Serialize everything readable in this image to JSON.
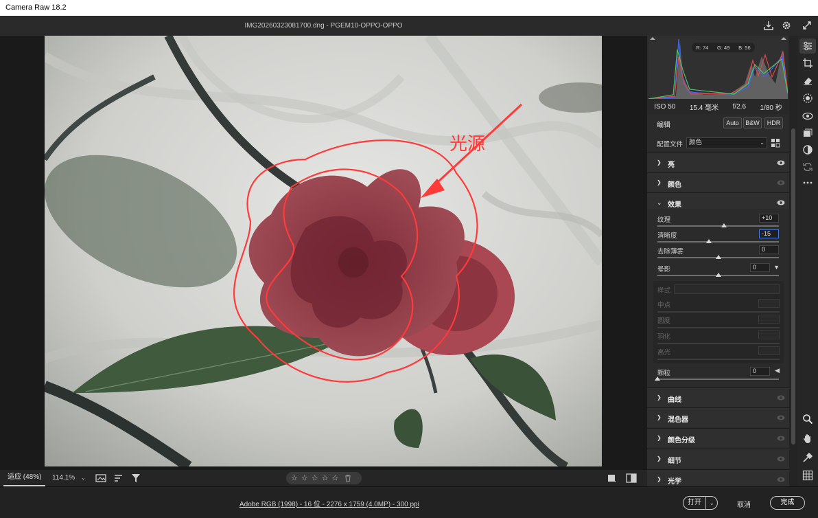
{
  "app": {
    "title": "Camera Raw 18.2"
  },
  "topbar": {
    "filename": "IMG20260323081700.dng - PGEM10-OPPO-OPPO"
  },
  "photo": {
    "annotation": "光源"
  },
  "histogram": {
    "r": "R: 74",
    "g": "G: 49",
    "b": "B: 56"
  },
  "exif": {
    "iso": "ISO 50",
    "focal": "15.4 毫米",
    "aperture": "f/2.6",
    "shutter": "1/80 秒"
  },
  "edit": {
    "title": "编辑",
    "auto": "Auto",
    "bw": "B&W",
    "hdr": "HDR"
  },
  "profile": {
    "label": "配置文件",
    "value": "颜色"
  },
  "sections": {
    "light": "亮",
    "color": "颜色",
    "effects": "效果",
    "curve": "曲线",
    "mixer": "混色器",
    "grading": "颜色分级",
    "detail": "细节",
    "optics": "光学"
  },
  "effects": {
    "texture": {
      "label": "纹理",
      "value": "+10",
      "pos": 0.55
    },
    "clarity": {
      "label": "清晰度",
      "value": "-15",
      "pos": 0.425
    },
    "dehaze": {
      "label": "去除薄雾",
      "value": "0",
      "pos": 0.5
    },
    "vignette": {
      "label": "晕影",
      "value": "0",
      "pos": 0.5
    },
    "style": {
      "label": "样式"
    },
    "midpoint": {
      "label": "中点"
    },
    "roundness": {
      "label": "圆度"
    },
    "feather": {
      "label": "羽化"
    },
    "highlights": {
      "label": "高光"
    },
    "grain": {
      "label": "颗粒",
      "value": "0",
      "pos": 0.0
    }
  },
  "canvasbar": {
    "fit": "适应 (48%)",
    "zoom": "114.1%"
  },
  "rating": {
    "stars": [
      "☆",
      "☆",
      "☆",
      "☆",
      "☆"
    ]
  },
  "footer": {
    "info": "Adobe RGB (1998) - 16 位 - 2276 x 1759 (4.0MP) - 300 ppi",
    "open": "打开",
    "cancel": "取消",
    "done": "完成"
  },
  "colors": {
    "annotation": "#ff3a3a",
    "panel": "#2b2b2b",
    "petal": "#8e3a46"
  }
}
